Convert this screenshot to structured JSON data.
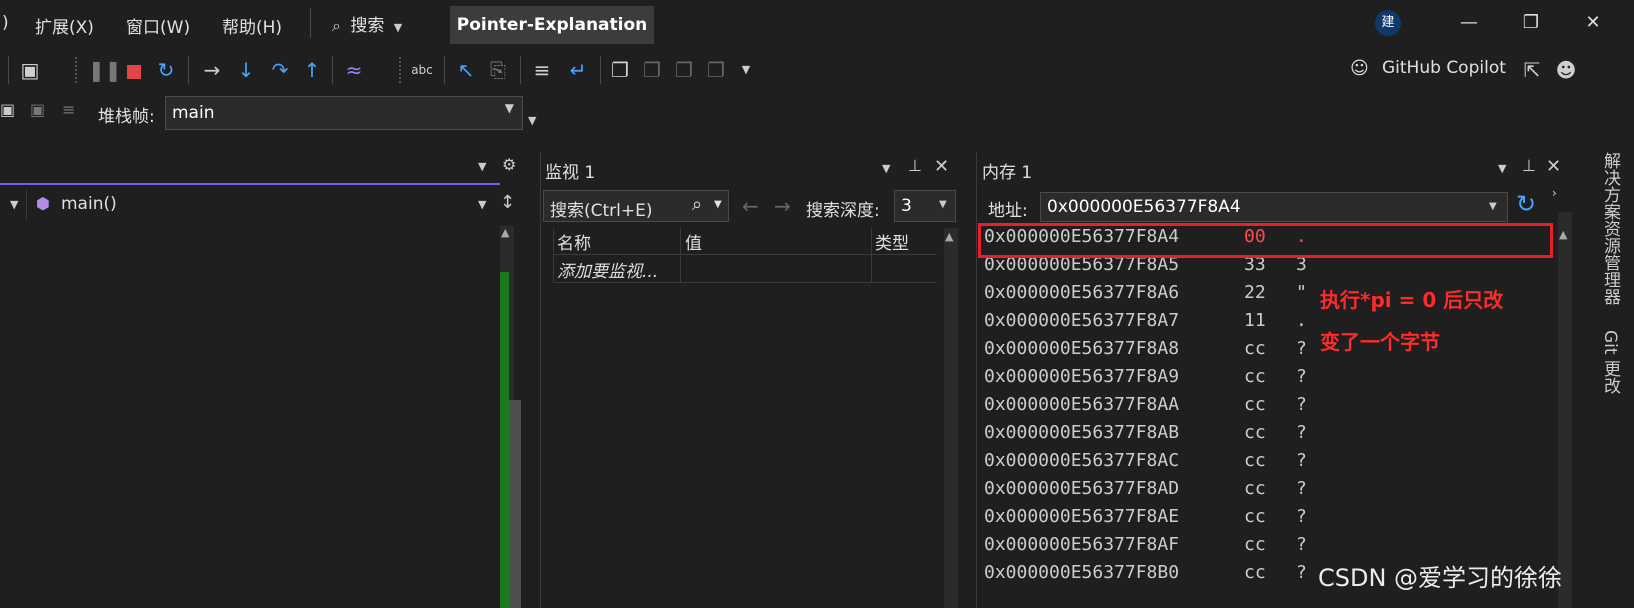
{
  "menu": {
    "items": [
      ")",
      "扩展(X)",
      "窗口(W)",
      "帮助(H)"
    ],
    "search_label": "搜索",
    "title": "Pointer-Explanation",
    "avatar": "建"
  },
  "toolbar": {
    "copilot_label": "GitHub Copilot",
    "icons": [
      "layout-icon",
      "pause-icon",
      "stop-icon",
      "restart-icon",
      "step-next-icon",
      "step-into-icon",
      "step-over-icon",
      "step-out-icon",
      "hot-reload-icon",
      "spellcheck-icon",
      "cursor-icon",
      "copy-icon",
      "outline-icon",
      "wrap-icon",
      "bookmark-icon"
    ]
  },
  "stackframe": {
    "label": "堆栈帧:",
    "value": "main"
  },
  "left_pane": {
    "function": "main()"
  },
  "watch": {
    "title": "监视 1",
    "search_placeholder": "搜索(Ctrl+E)",
    "depth_label": "搜索深度:",
    "depth_value": "3",
    "columns": [
      "名称",
      "值",
      "类型"
    ],
    "add_row": "添加要监视..."
  },
  "memory": {
    "title": "内存 1",
    "address_label": "地址:",
    "address_value": "0x000000E56377F8A4",
    "rows": [
      {
        "addr": "0x000000E56377F8A4",
        "hex": "00",
        "text": "."
      },
      {
        "addr": "0x000000E56377F8A5",
        "hex": "33",
        "text": "3"
      },
      {
        "addr": "0x000000E56377F8A6",
        "hex": "22",
        "text": "\""
      },
      {
        "addr": "0x000000E56377F8A7",
        "hex": "11",
        "text": "."
      },
      {
        "addr": "0x000000E56377F8A8",
        "hex": "cc",
        "text": "?"
      },
      {
        "addr": "0x000000E56377F8A9",
        "hex": "cc",
        "text": "?"
      },
      {
        "addr": "0x000000E56377F8AA",
        "hex": "cc",
        "text": "?"
      },
      {
        "addr": "0x000000E56377F8AB",
        "hex": "cc",
        "text": "?"
      },
      {
        "addr": "0x000000E56377F8AC",
        "hex": "cc",
        "text": "?"
      },
      {
        "addr": "0x000000E56377F8AD",
        "hex": "cc",
        "text": "?"
      },
      {
        "addr": "0x000000E56377F8AE",
        "hex": "cc",
        "text": "?"
      },
      {
        "addr": "0x000000E56377F8AF",
        "hex": "cc",
        "text": "?"
      },
      {
        "addr": "0x000000E56377F8B0",
        "hex": "cc",
        "text": "?"
      }
    ],
    "annotation_line1": "执行*pi = 0 后只改",
    "annotation_line2": "变了一个字节"
  },
  "side_tabs": [
    "解决方案资源管理器",
    "Git 更改"
  ],
  "watermark": "CSDN @爱学习的徐徐",
  "colors": {
    "highlight": "#e8202a",
    "changed_byte": "#ff4a4a",
    "accent_purple": "#7160e8",
    "change_bar": "#1b7a1b"
  }
}
